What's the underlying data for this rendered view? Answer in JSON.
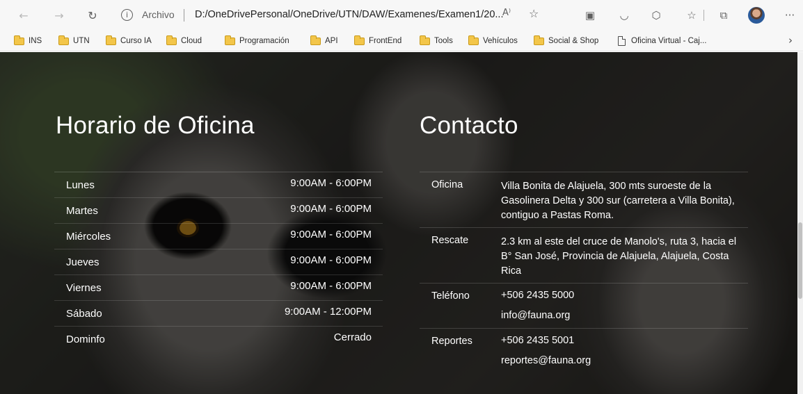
{
  "browser": {
    "address_scheme": "Archivo",
    "address_url": "D:/OneDrivePersonal/OneDrive/UTN/DAW/Examenes/Examen1/20...",
    "bookmarks": [
      {
        "label": "INS",
        "icon": "folder"
      },
      {
        "label": "UTN",
        "icon": "folder"
      },
      {
        "label": "Curso IA",
        "icon": "folder"
      },
      {
        "label": "Cloud",
        "icon": "folder"
      },
      {
        "label": "Programación",
        "icon": "folder"
      },
      {
        "label": "API",
        "icon": "folder"
      },
      {
        "label": "FrontEnd",
        "icon": "folder"
      },
      {
        "label": "Tools",
        "icon": "folder"
      },
      {
        "label": "Vehículos",
        "icon": "folder"
      },
      {
        "label": "Social & Shop",
        "icon": "folder"
      },
      {
        "label": "Oficina Virtual - Caj...",
        "icon": "page"
      }
    ]
  },
  "page": {
    "hours_title": "Horario de Oficina",
    "contact_title": "Contacto",
    "hours": [
      {
        "day": "Lunes",
        "time": "9:00AM - 6:00PM"
      },
      {
        "day": "Martes",
        "time": "9:00AM - 6:00PM"
      },
      {
        "day": "Miércoles",
        "time": "9:00AM - 6:00PM"
      },
      {
        "day": "Jueves",
        "time": "9:00AM - 6:00PM"
      },
      {
        "day": "Viernes",
        "time": "9:00AM - 6:00PM"
      },
      {
        "day": "Sábado",
        "time": "9:00AM - 12:00PM"
      },
      {
        "day": "Dominfo",
        "time": "Cerrado"
      }
    ],
    "contact": [
      {
        "label": "Oficina",
        "value": "Villa Bonita de Alajuela, 300 mts suroeste de la Gasolinera Delta y 300 sur (carretera a Villa Bonita), contiguo a Pastas Roma."
      },
      {
        "label": "Rescate",
        "value": "2.3 km al este del cruce de Manolo's, ruta 3, hacia el B° San José, Provincia de Alajuela, Alajuela, Costa Rica"
      },
      {
        "label": "Teléfono",
        "phone": "+506 2435 5000",
        "email": "info@fauna.org"
      },
      {
        "label": "Reportes",
        "phone": "+506 2435 5001",
        "email": "reportes@fauna.org"
      }
    ]
  }
}
